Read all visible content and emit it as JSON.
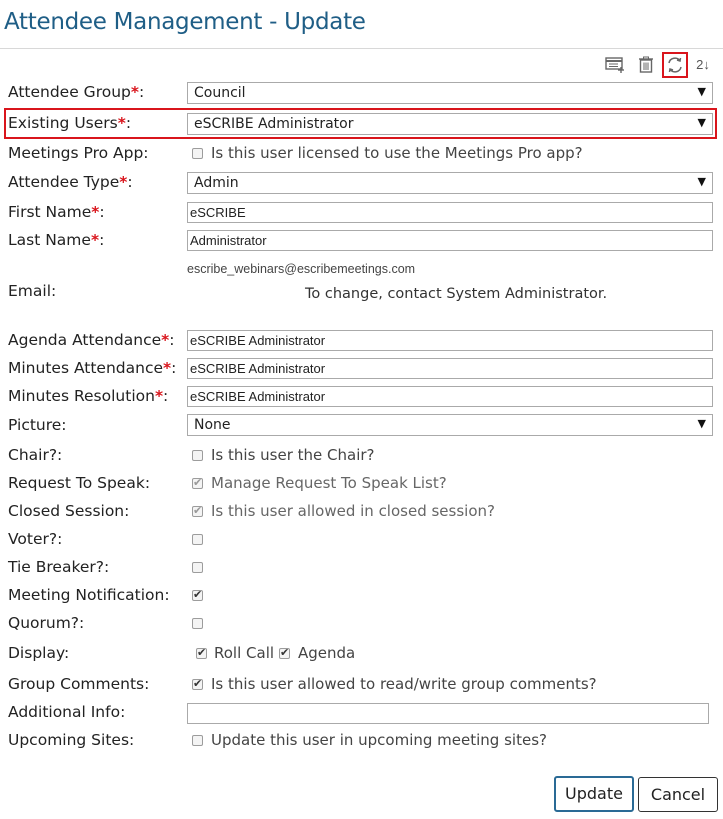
{
  "page_title": "Attendee Management - Update",
  "toolbar": {
    "icons": [
      "add-list-icon",
      "trash-icon",
      "refresh-icon",
      "sort-icon"
    ],
    "sort_text": "2↓"
  },
  "form": {
    "attendee_group": {
      "label": "Attendee Group",
      "required": "*",
      "value": "Council"
    },
    "existing_users": {
      "label": "Existing Users",
      "required": "*",
      "value": "eSCRIBE Administrator"
    },
    "meetings_pro_app": {
      "label": "Meetings Pro App:",
      "text": "Is this user licensed to use the Meetings Pro app?",
      "checked": false
    },
    "attendee_type": {
      "label": "Attendee Type",
      "required": "*",
      "value": "Admin"
    },
    "first_name": {
      "label": "First Name",
      "required": "*",
      "value": "eSCRIBE"
    },
    "last_name": {
      "label": "Last Name",
      "required": "*",
      "value": "Administrator"
    },
    "email": {
      "label": "Email:",
      "value": "escribe_webinars@escribemeetings.com",
      "note": "To change, contact System Administrator."
    },
    "agenda_attendance": {
      "label": "Agenda Attendance",
      "required": "*",
      "value": "eSCRIBE Administrator"
    },
    "minutes_attendance": {
      "label": "Minutes Attendance",
      "required": "*",
      "value": "eSCRIBE Administrator"
    },
    "minutes_resolution": {
      "label": "Minutes Resolution",
      "required": "*",
      "value": "eSCRIBE Administrator"
    },
    "picture": {
      "label": "Picture:",
      "value": "None"
    },
    "chair": {
      "label": "Chair?:",
      "text": "Is this user the Chair?",
      "checked": false
    },
    "request_to_speak": {
      "label": "Request To Speak:",
      "text": "Manage Request To Speak List?",
      "checked": true
    },
    "closed_session": {
      "label": "Closed Session:",
      "text": "Is this user allowed in closed session?",
      "checked": true
    },
    "voter": {
      "label": "Voter?:",
      "checked": false
    },
    "tie_breaker": {
      "label": "Tie Breaker?:",
      "checked": false
    },
    "meeting_notification": {
      "label": "Meeting Notification:",
      "checked": true
    },
    "quorum": {
      "label": "Quorum?:",
      "checked": false
    },
    "display": {
      "label": "Display:",
      "roll_call": "Roll Call",
      "agenda": "Agenda",
      "roll_call_checked": true,
      "agenda_checked": true
    },
    "group_comments": {
      "label": "Group Comments:",
      "text": "Is this user allowed to read/write group comments?",
      "checked": true
    },
    "additional_info": {
      "label": "Additional Info:",
      "value": ""
    },
    "upcoming_sites": {
      "label": "Upcoming Sites:",
      "text": "Update this user in upcoming meeting sites?",
      "checked": false
    }
  },
  "buttons": {
    "update": "Update",
    "cancel": "Cancel"
  },
  "colors": {
    "title": "#1f5e86",
    "required": "#d9151c",
    "highlight": "#d9151c"
  }
}
